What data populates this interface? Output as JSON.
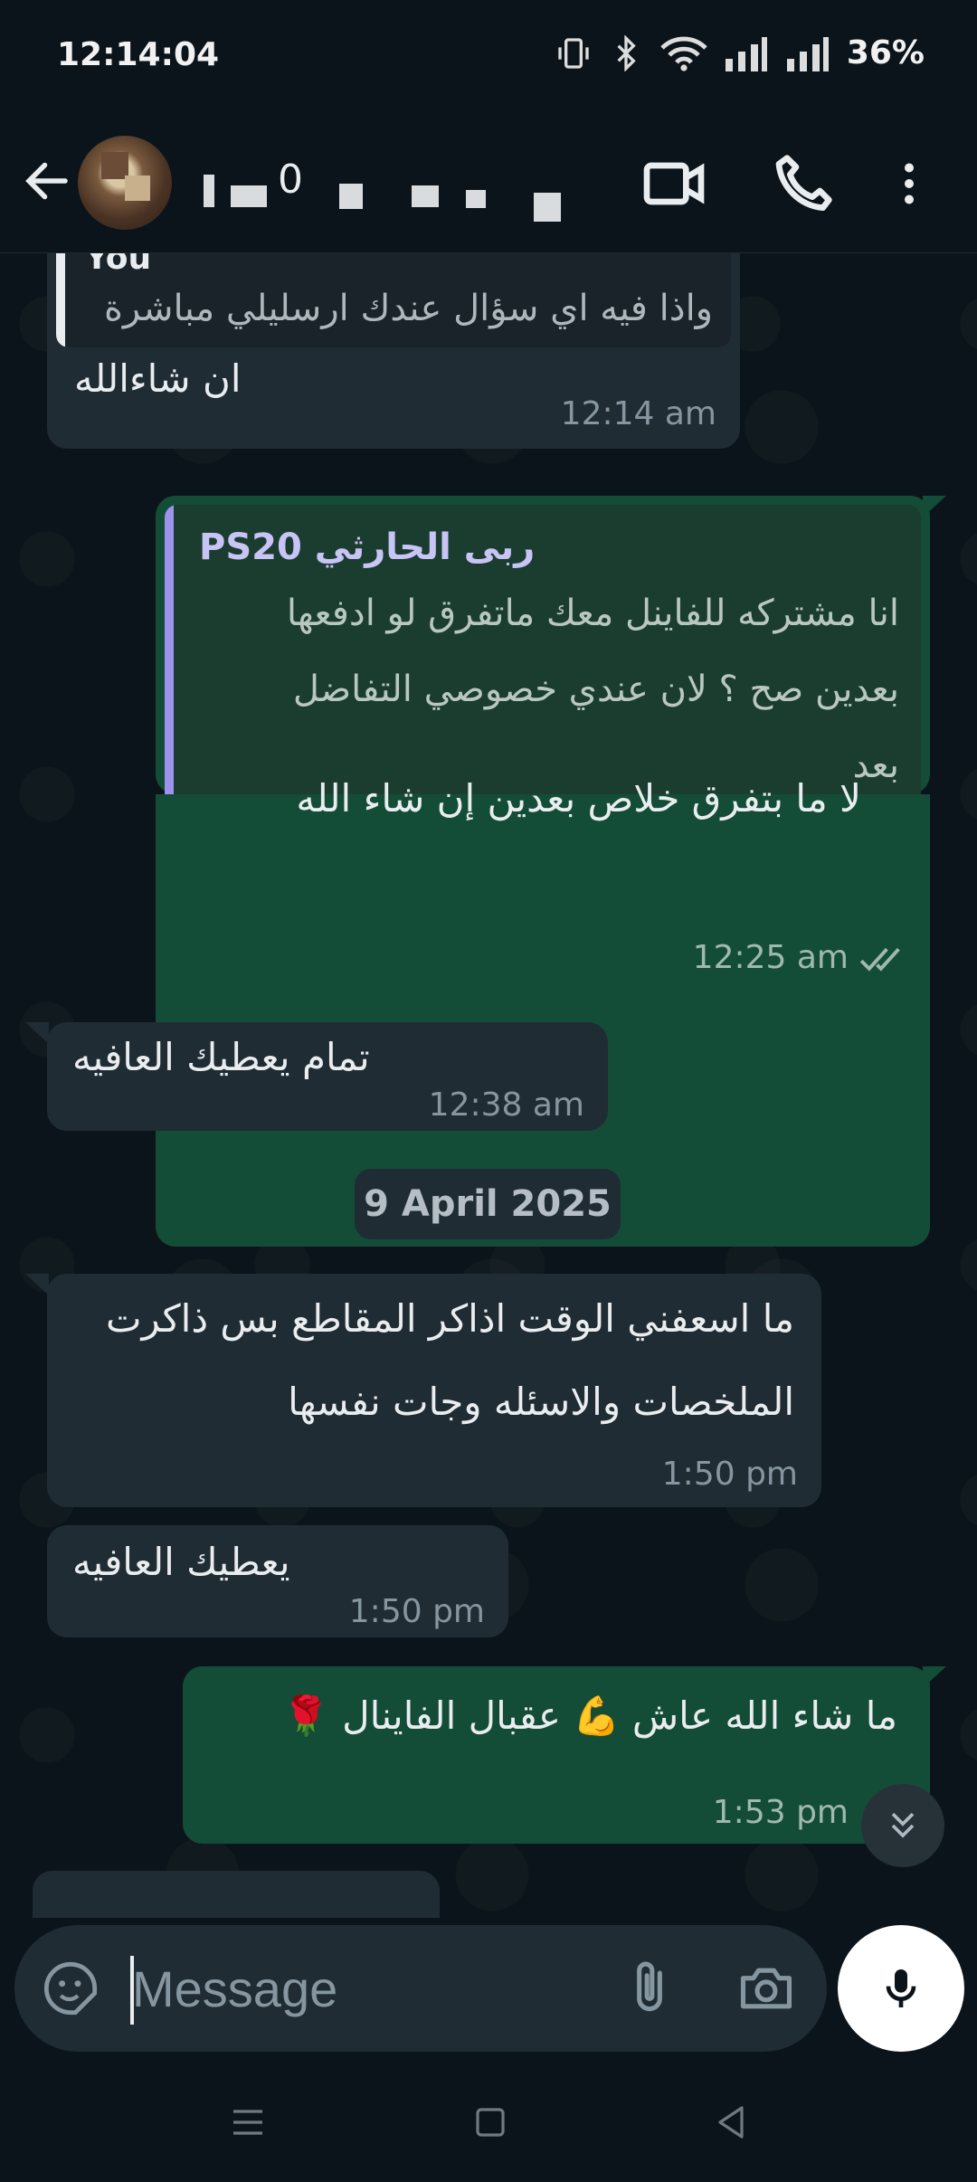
{
  "status_bar": {
    "time": "12:14:04",
    "battery": "36%"
  },
  "header": {
    "name_visible_fragment": "ب الـ ر0"
  },
  "messages": [
    {
      "id": "m1",
      "dir": "in",
      "quote_author": "You",
      "quote_text": "واذا فيه اي سؤال عندك ارسليلي مباشرة",
      "text": "ان شاءالله",
      "time": "12:14 am"
    },
    {
      "id": "m2",
      "dir": "out",
      "quote_author": "ربى الحارثي PS20",
      "quote_lines": [
        "انا مشتركه للفاينل معك ماتفرق لو ادفعها",
        "بعدين صح ؟ لان عندي خصوصي التفاضل",
        "بعد"
      ],
      "text": "لا ما بتفرق خلاص بعدين إن شاء الله",
      "time": "12:25 am"
    },
    {
      "id": "m3",
      "dir": "in",
      "text": "تمام يعطيك العافيه",
      "time": "12:38 am"
    },
    {
      "id": "m4",
      "dir": "in",
      "lines": [
        "ما اسعفني الوقت اذاكر المقاطع بس ذاكرت",
        "الملخصات والاسئله وجات نفسها"
      ],
      "time": "1:50 pm"
    },
    {
      "id": "m5",
      "dir": "in",
      "text": "يعطيك العافيه",
      "time": "1:50 pm"
    },
    {
      "id": "m6",
      "dir": "out",
      "text": "ما شاء الله عاش 💪 عقبال الفاينال 🌹",
      "time": "1:53 pm"
    }
  ],
  "date_separator": "9 April 2025",
  "input": {
    "placeholder": "Message"
  },
  "colors": {
    "incoming": "#202c33",
    "outgoing": "#144d37",
    "background": "#0b141a",
    "quote_accent": "#9d93ec"
  },
  "icons": [
    "back-arrow-icon",
    "video-call-icon",
    "phone-icon",
    "more-vert-icon",
    "sticker-icon",
    "attach-icon",
    "camera-icon",
    "mic-icon",
    "double-chevron-down-icon",
    "read-ticks-icon"
  ]
}
